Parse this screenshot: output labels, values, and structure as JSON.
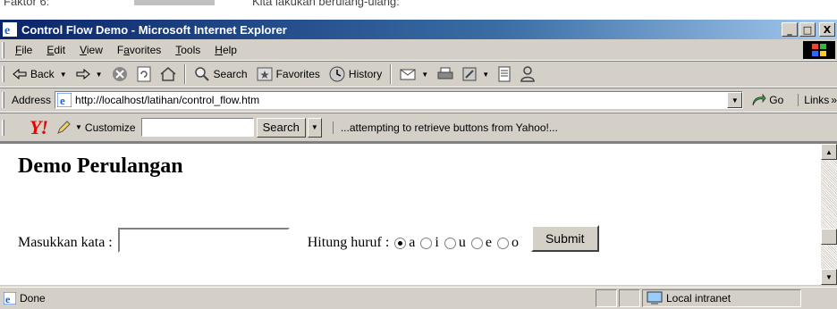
{
  "window": {
    "title": "Control Flow Demo - Microsoft Internet Explorer",
    "buttons": [
      "_",
      "□",
      "X"
    ]
  },
  "topstrip": {
    "left_text": "Faktor 6:",
    "mid_text": "Kita lakukan berulang-ulang:"
  },
  "menu": [
    "File",
    "Edit",
    "View",
    "Favorites",
    "Tools",
    "Help"
  ],
  "menu_accel": [
    "F",
    "E",
    "V",
    "a",
    "T",
    "H"
  ],
  "toolbar": {
    "back": "Back",
    "search": "Search",
    "favorites": "Favorites",
    "history": "History"
  },
  "address": {
    "label": "Address",
    "url": "http://localhost/latihan/control_flow.htm",
    "go": "Go",
    "links": "Links"
  },
  "yahoo": {
    "logo": "Y!",
    "customize": "Customize",
    "search_button": "Search",
    "search_value": "",
    "status_message": "...attempting to retrieve buttons from Yahoo!..."
  },
  "page": {
    "heading": "Demo Perulangan",
    "input_label": "Masukkan kata :",
    "input_value": "",
    "count_label": "Hitung huruf :",
    "options": [
      "a",
      "i",
      "u",
      "e",
      "o"
    ],
    "selected_option": "a",
    "submit": "Submit"
  },
  "status": {
    "text": "Done",
    "zone": "Local intranet"
  },
  "colors": {
    "titlebar": "#0a246a",
    "chrome": "#d4d0c8",
    "yahoo_red": "#e00000"
  }
}
